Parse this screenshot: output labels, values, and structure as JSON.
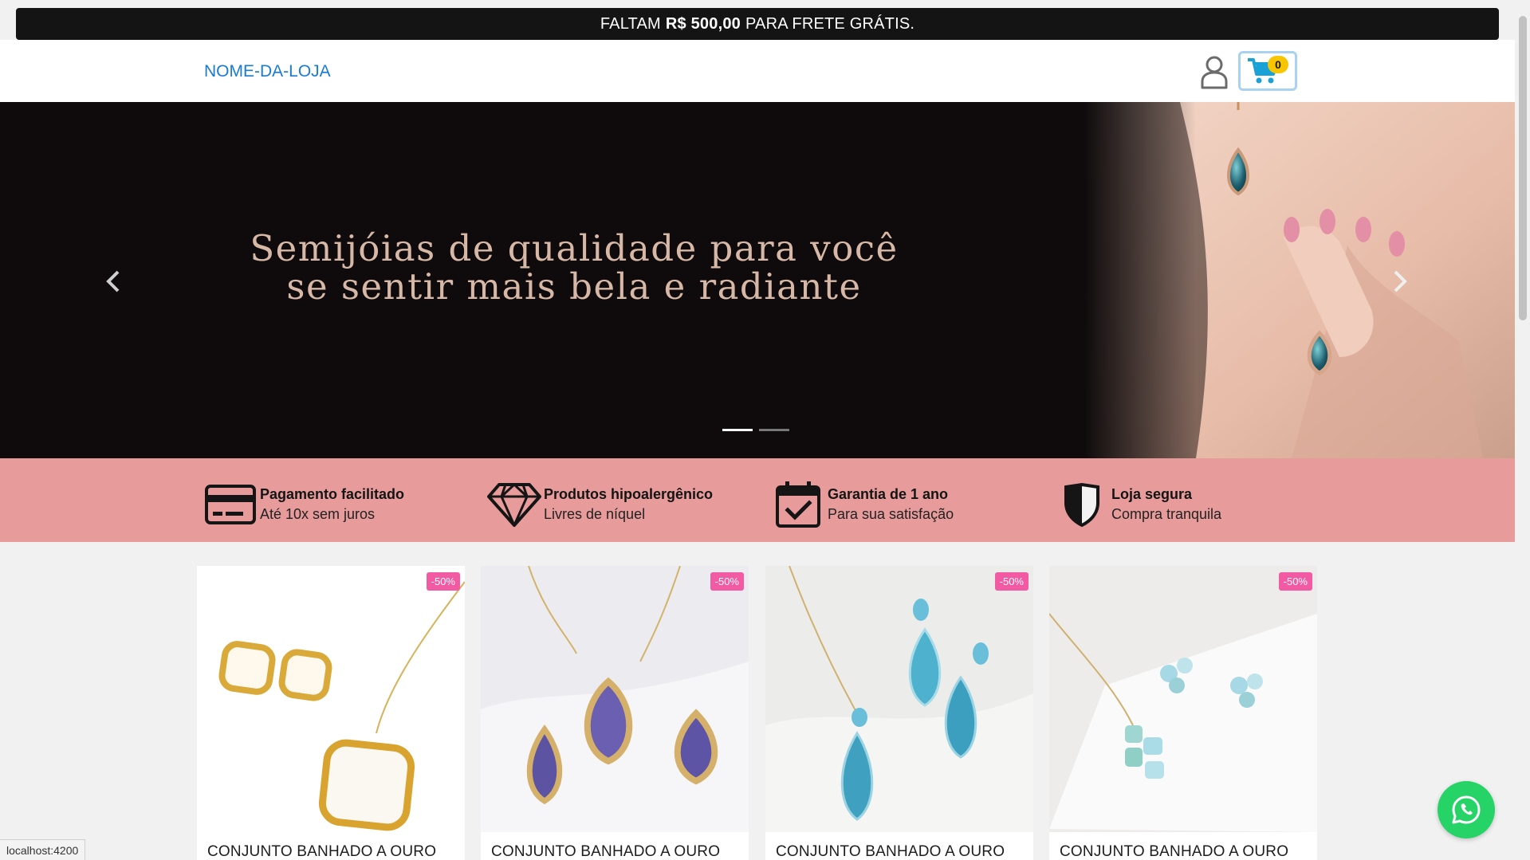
{
  "notice": {
    "prefix": "FALTAM",
    "amount": "R$ 500,00",
    "suffix": "PARA FRETE GRÁTIS."
  },
  "header": {
    "store_name": "NOME-DA-LOJA",
    "cart_count": "0"
  },
  "hero": {
    "headline": "Semijóias de qualidade para você se sentir mais bela e radiante",
    "slides": 2,
    "active_slide": 1
  },
  "features": [
    {
      "title": "Pagamento facilitado",
      "subtitle": "Até 10x sem juros",
      "icon": "credit-card-icon"
    },
    {
      "title": "Produtos hipoalergênico",
      "subtitle": "Livres de níquel",
      "icon": "diamond-icon"
    },
    {
      "title": "Garantia de 1 ano",
      "subtitle": "Para sua satisfação",
      "icon": "calendar-check-icon"
    },
    {
      "title": "Loja segura",
      "subtitle": "Compra tranquila",
      "icon": "shield-icon"
    }
  ],
  "products": [
    {
      "name": "CONJUNTO BANHADO A OURO",
      "discount": "-50%"
    },
    {
      "name": "CONJUNTO BANHADO A OURO",
      "discount": "-50%"
    },
    {
      "name": "CONJUNTO BANHADO A OURO",
      "discount": "-50%"
    },
    {
      "name": "CONJUNTO BANHADO A OURO",
      "discount": "-50%"
    }
  ],
  "status_bar": {
    "url": "localhost:4200"
  },
  "colors": {
    "accent": "#1a7bd3",
    "features_band": "#e79b9b",
    "badge": "#f25aa3",
    "cart_count_bg": "#f7c600",
    "whatsapp": "#25d366"
  }
}
